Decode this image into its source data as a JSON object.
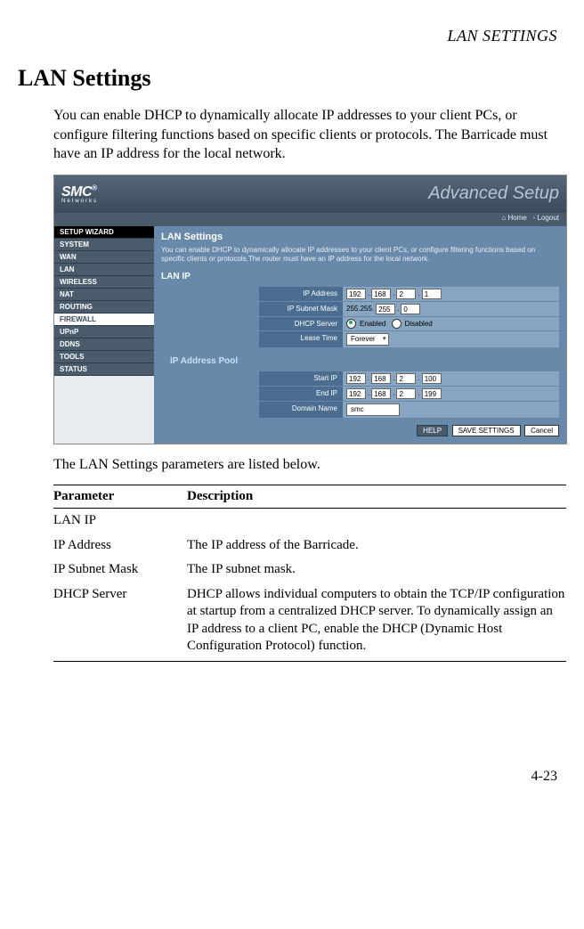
{
  "header": {
    "running": "LAN SETTINGS"
  },
  "section": {
    "title": "LAN Settings",
    "intro": "You can enable DHCP to dynamically allocate IP addresses to your client PCs, or configure filtering functions based on specific clients or protocols. The Barricade must have an IP address for the local network.",
    "caption": "The LAN Settings parameters are listed below."
  },
  "screenshot": {
    "brand": "SMC",
    "brand_reg": "®",
    "brand_sub": "Networks",
    "adv": "Advanced Setup",
    "home": "Home",
    "logout": "Logout",
    "nav": [
      "SETUP WIZARD",
      "SYSTEM",
      "WAN",
      "LAN",
      "WIRELESS",
      "NAT",
      "ROUTING",
      "FIREWALL",
      "UPnP",
      "DDNS",
      "TOOLS",
      "STATUS"
    ],
    "h1": "LAN Settings",
    "desc": "You can enable DHCP to dynamically allocate IP addresses to your client PCs, or configure filtering functions based on specific clients or protocols.The router must have an IP address for the local network.",
    "h2": "LAN IP",
    "fields": {
      "ip_address_label": "IP Address",
      "ip_address": [
        "192",
        "168",
        "2",
        "1"
      ],
      "subnet_label": "IP Subnet Mask",
      "subnet_fixed": "255.255.",
      "subnet": [
        "255",
        "0"
      ],
      "dhcp_label": "DHCP Server",
      "dhcp_enabled": "Enabled",
      "dhcp_disabled": "Disabled",
      "lease_label": "Lease Time",
      "lease_value": "Forever"
    },
    "pool": {
      "title": "IP Address Pool",
      "start_label": "Start IP",
      "start": [
        "192",
        "168",
        "2",
        "100"
      ],
      "end_label": "End IP",
      "end": [
        "192",
        "168",
        "2",
        "199"
      ],
      "domain_label": "Domain Name",
      "domain_value": "smc"
    },
    "buttons": {
      "help": "HELP",
      "save": "SAVE SETTINGS",
      "cancel": "Cancel"
    }
  },
  "table": {
    "headers": {
      "param": "Parameter",
      "desc": "Description"
    },
    "rows": [
      {
        "p": "LAN IP",
        "d": "",
        "indent": false
      },
      {
        "p": "IP Address",
        "d": "The IP address of the Barricade.",
        "indent": true
      },
      {
        "p": "IP Subnet Mask",
        "d": "The IP subnet mask.",
        "indent": true
      },
      {
        "p": "DHCP Server",
        "d": "DHCP allows individual computers to obtain the TCP/IP configuration at startup from a centralized DHCP server. To dynamically assign an IP address to a client PC, enable the DHCP (Dynamic Host Configuration Protocol) function.",
        "indent": false
      }
    ]
  },
  "page_number": "4-23"
}
